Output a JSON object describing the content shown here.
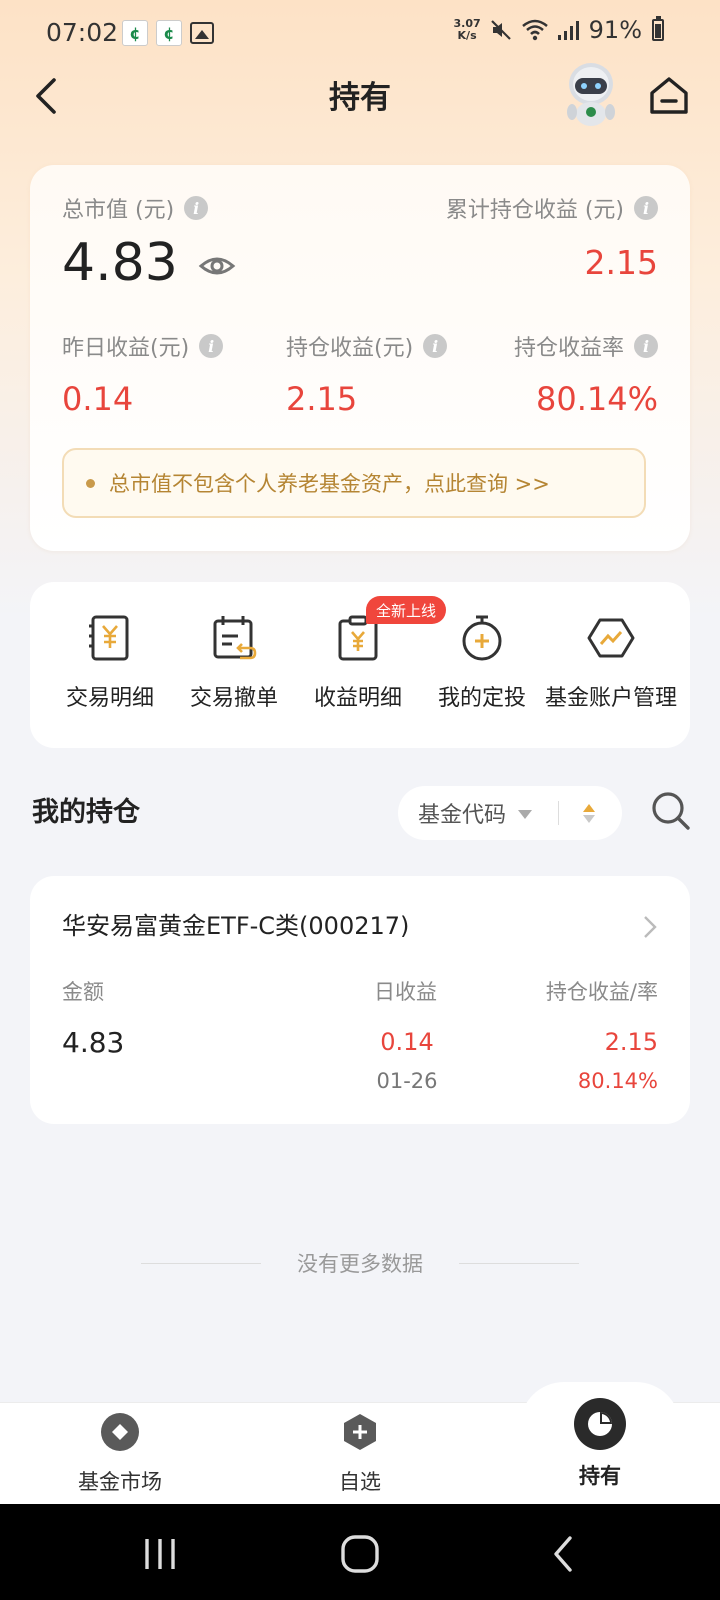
{
  "status_bar": {
    "time": "07:02",
    "net_speed_value": "3.07",
    "net_speed_unit": "K/s",
    "battery": "91%",
    "notif_icons": [
      "app-notification-icon",
      "app-notification-icon",
      "image-icon"
    ]
  },
  "header": {
    "title": "持有"
  },
  "summary": {
    "total_label": "总市值 (元)",
    "total_value": "4.83",
    "cum_label": "累计持仓收益 (元)",
    "cum_value": "2.15",
    "metrics": [
      {
        "label": "昨日收益(元)",
        "value": "0.14"
      },
      {
        "label": "持仓收益(元)",
        "value": "2.15"
      },
      {
        "label": "持仓收益率",
        "value": "80.14%"
      }
    ],
    "notice": "总市值不包含个人养老基金资产，点此查询 >>"
  },
  "actions": {
    "items": [
      {
        "label": "交易明细",
        "icon": "transaction-detail-icon"
      },
      {
        "label": "交易撤单",
        "icon": "cancel-order-icon"
      },
      {
        "label": "收益明细",
        "icon": "income-detail-icon"
      },
      {
        "label": "我的定投",
        "icon": "fixed-investment-icon"
      },
      {
        "label": "基金账户管理",
        "icon": "account-manage-icon"
      }
    ],
    "new_badge": "全新上线"
  },
  "holdings": {
    "section_title": "我的持仓",
    "sort_label": "基金代码",
    "items": [
      {
        "fund_name": "华安易富黄金ETF-C类(000217)",
        "col_amount": "金额",
        "col_daily": "日收益",
        "col_profit": "持仓收益/率",
        "amount": "4.83",
        "daily_profit": "0.14",
        "daily_date": "01-26",
        "profit": "2.15",
        "profit_rate": "80.14%"
      }
    ],
    "no_more": "没有更多数据"
  },
  "tabbar": {
    "tabs": [
      {
        "label": "基金市场",
        "icon": "fund-market-icon"
      },
      {
        "label": "自选",
        "icon": "watchlist-add-icon"
      },
      {
        "label": "持有",
        "icon": "holdings-pie-icon",
        "active": true
      }
    ]
  },
  "colors": {
    "profit_red": "#e8453c",
    "notice_gold": "#b58533",
    "accent_orange": "#e8a93a"
  }
}
